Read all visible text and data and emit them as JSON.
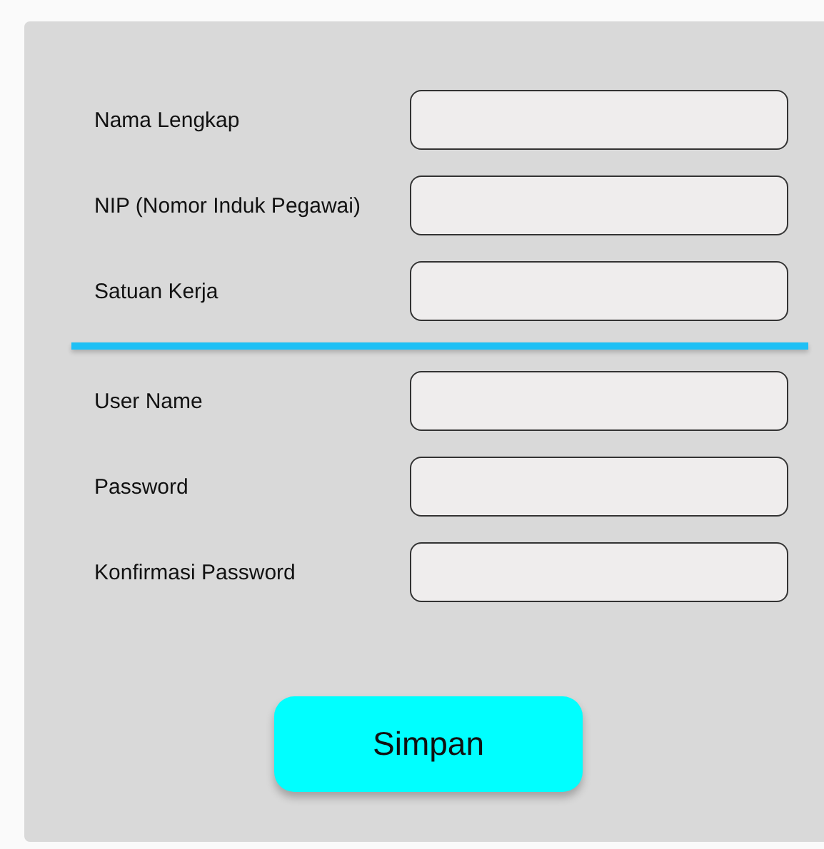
{
  "sections": [
    {
      "fields": [
        {
          "label": "Nama Lengkap"
        },
        {
          "label": "NIP (Nomor Induk Pegawai)"
        },
        {
          "label": "Satuan Kerja"
        }
      ]
    },
    {
      "fields": [
        {
          "label": "User Name"
        },
        {
          "label": "Password"
        },
        {
          "label": "Konfirmasi Password"
        }
      ]
    }
  ],
  "button": {
    "label": "Simpan"
  }
}
